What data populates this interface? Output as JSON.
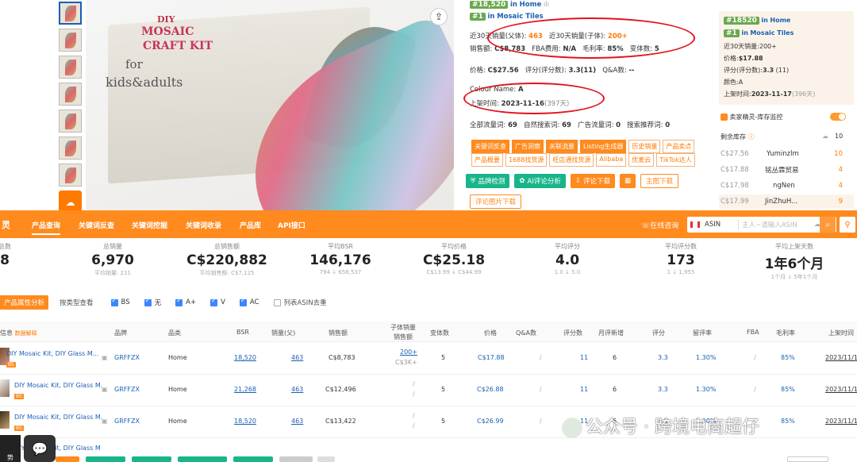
{
  "product": {
    "box_text": [
      "DIY",
      "MOSAIC",
      "CRAFT KIT",
      "for",
      "kids&adults"
    ],
    "rank1": {
      "badge": "#18,520",
      "in": "in",
      "category": "Home"
    },
    "rank2": {
      "badge": "#1",
      "in": "in",
      "category": "Mosaic Tiles"
    },
    "sales_parent_label": "近30天销量(父体):",
    "sales_parent": "463",
    "sales_child_label": "近30天销量(子体):",
    "sales_child": "200+",
    "revenue_label": "销售额:",
    "revenue": "C$8,783",
    "fba_label": "FBA费用:",
    "fba": "N/A",
    "margin_label": "毛利率:",
    "margin": "85%",
    "variants_label": "变体数:",
    "variants": "5",
    "price_label": "价格:",
    "price": "C$27.56",
    "rating_label": "评分(评分数):",
    "rating": "3.3(11)",
    "qa_label": "Q&A数:",
    "qa": "--",
    "colour_label": "Colour Name:",
    "colour": "A",
    "listed_label": "上架时间:",
    "listed": "2023-11-16",
    "listed_age": "(397天)",
    "traffic_label": "全部流量词:",
    "traffic": "69",
    "organic_label": "自然搜索词:",
    "organic": "69",
    "ad_label": "广告流量词:",
    "ad": "0",
    "rec_label": "搜索推荐词:",
    "rec": "0"
  },
  "tags_row1": [
    {
      "label": "关键词反查",
      "fill": true
    },
    {
      "label": "广告洞察",
      "fill": true
    },
    {
      "label": "关联流量",
      "fill": true
    },
    {
      "label": "Listing生成器",
      "fill": true
    },
    {
      "label": "历史销量",
      "fill": false
    },
    {
      "label": "产品卖点",
      "fill": false
    }
  ],
  "tags_row2": [
    {
      "label": "产品概要"
    },
    {
      "label": "1688找货源"
    },
    {
      "label": "旺店通找货源"
    },
    {
      "label": "Alibaba"
    },
    {
      "label": "优麦云"
    },
    {
      "label": "TikTok达人"
    }
  ],
  "action_buttons": {
    "check": "品牌检测",
    "ai": "AI评论分析",
    "review_dl": "评论下载",
    "calc": "▦",
    "main_img_dl": "主图下载",
    "review_img_dl": "评论图片下载"
  },
  "right_panel": {
    "rank1": {
      "badge": "#18520",
      "in": "in",
      "category": "Home"
    },
    "rank2": {
      "badge": "#1",
      "in": "in",
      "category": "Mosaic Tiles"
    },
    "sales": "近30天销量:200+",
    "price_label": "价格:",
    "price": "$17.88",
    "rating_label": "评分(评分数):",
    "rating": "3.3",
    "rating_count": "(11)",
    "color": "颜色:A",
    "listed_label": "上架时间:",
    "listed": "2023-11-17",
    "listed_age": "(396天)",
    "monitor_label": "卖家精灵-库存监控",
    "stock_label": "剩余库存",
    "inventory": [
      {
        "price": "C$27.56",
        "seller": "Yuminzlm",
        "qty": "10"
      },
      {
        "price": "C$17.88",
        "seller": "铭丛霖贸易",
        "qty": "4"
      },
      {
        "price": "C$17.98",
        "seller": "ngNen",
        "qty": "4"
      },
      {
        "price": "C$17.99",
        "seller": "JinZhuH...",
        "qty": "9"
      }
    ]
  },
  "nav": {
    "logo": "灵",
    "items": [
      "产品查询",
      "关键词反查",
      "关键词挖掘",
      "关键词收录",
      "产品库",
      "API接口"
    ],
    "online": "在线咨询",
    "search_type": "ASIN",
    "search_placeholder": "主人~请输入ASIN"
  },
  "stats": [
    {
      "label": "总数",
      "value": "8",
      "sub": ""
    },
    {
      "label": "总销量",
      "value": "6,970",
      "sub": "平均销量: 211"
    },
    {
      "label": "总销售额",
      "value": "C$220,882",
      "sub": "平均销售额: C$7,125"
    },
    {
      "label": "平均BSR",
      "value": "146,176",
      "sub": "794 ↓ 658,537"
    },
    {
      "label": "平均价格",
      "value": "C$25.18",
      "sub": "C$13.99 ↓ C$44.99"
    },
    {
      "label": "平均评分",
      "value": "4.0",
      "sub": "1.0 ↓ 5.0"
    },
    {
      "label": "平均评分数",
      "value": "173",
      "sub": "1 ↓ 1,955"
    },
    {
      "label": "平均上架天数",
      "value": "1年6个月",
      "sub": "1个月 ↓ 5年1个月"
    }
  ],
  "filters": {
    "tab1": "产品属性分析",
    "tab2": "按类型查看",
    "checks": [
      "BS",
      "无",
      "A+",
      "V",
      "AC"
    ],
    "dedupe": "列表ASIN去重"
  },
  "table": {
    "headers": {
      "info": "信息",
      "help": "数据解释",
      "brand": "品牌",
      "category": "品类",
      "bsr": "BSR",
      "sales": "销量(父)",
      "revenue": "销售额",
      "child_sales": "子体销量",
      "child_rev": "销售额",
      "variants": "变体数",
      "price": "价格",
      "qa": "Q&A数",
      "ratings": "评分数",
      "new_ratings": "月评新增",
      "rating": "评分",
      "retention": "留评率",
      "fba": "FBA",
      "margin": "毛利率",
      "listed": "上架时间"
    },
    "rows": [
      {
        "title": "DIY Mosaic Kit, DIY Glass M...",
        "brand": "GRFFZX",
        "category": "Home",
        "bsr": "18,520",
        "sales": "463",
        "revenue": "C$8,783",
        "child_sales": "200+",
        "child_rev": "C$3K+",
        "variants": "5",
        "price": "C$17.88",
        "qa": "/",
        "ratings": "11",
        "new_ratings": "6",
        "rating": "3.3",
        "retention": "1.30%",
        "fba": "/",
        "margin": "85%",
        "listed": "2023/11/1"
      },
      {
        "title": "DIY Mosaic Kit, DIY Glass M.",
        "brand": "GRFFZX",
        "category": "Home",
        "bsr": "21,268",
        "sales": "463",
        "revenue": "C$12,496",
        "child_sales": "/",
        "child_rev": "/",
        "variants": "5",
        "price": "C$26.88",
        "qa": "/",
        "ratings": "11",
        "new_ratings": "6",
        "rating": "3.3",
        "retention": "1.30%",
        "fba": "/",
        "margin": "85%",
        "listed": "2023/11/1"
      },
      {
        "title": "DIY Mosaic Kit, DIY Glass M.",
        "brand": "GRFFZX",
        "category": "Home",
        "bsr": "18,520",
        "sales": "463",
        "revenue": "C$13,422",
        "child_sales": "/",
        "child_rev": "/",
        "variants": "5",
        "price": "C$26.99",
        "qa": "/",
        "ratings": "11",
        "new_ratings": "6",
        "rating": "3.3",
        "retention": "1.30%",
        "fba": "/",
        "margin": "85%",
        "listed": "2023/11/1"
      }
    ],
    "partial_row_title": "DIY Mosaic Kit, DIY Glass M"
  },
  "watermark": "公众号 · 跨境电商超仔",
  "side": {
    "trend": "势"
  }
}
